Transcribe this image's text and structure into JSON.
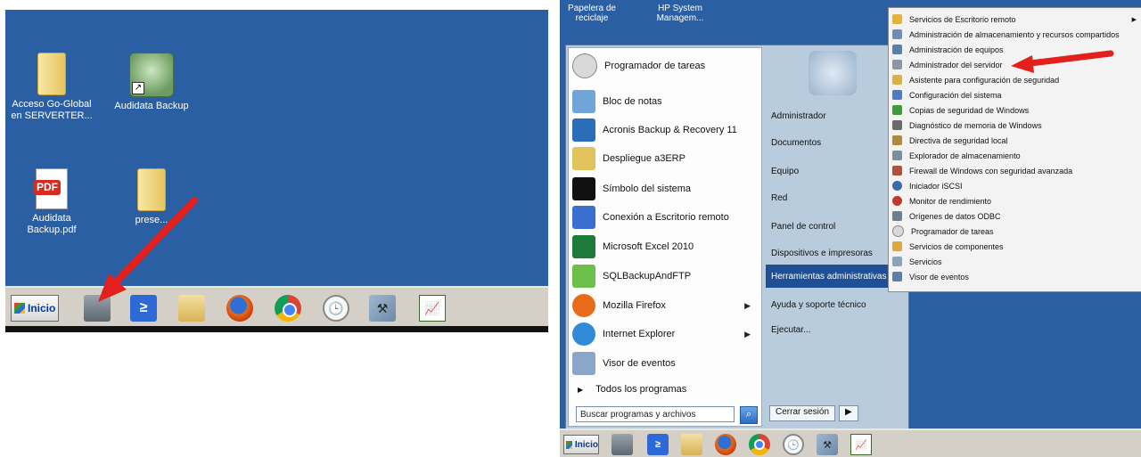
{
  "left_panel": {
    "desktop_icons": [
      {
        "label": "Acceso Go-Global en SERVERTER...",
        "icon": "folder-icon"
      },
      {
        "label": "Audidata Backup",
        "icon": "audidata-app-icon"
      },
      {
        "label": "Audidata Backup.pdf",
        "icon": "pdf-icon"
      },
      {
        "label": "prese...",
        "icon": "folder-icon"
      }
    ],
    "taskbar": {
      "start_label": "Inicio",
      "icons": [
        "server-manager-icon",
        "powershell-icon",
        "explorer-icon",
        "firefox-icon",
        "chrome-icon",
        "clock-icon",
        "admin-tools-icon",
        "performance-chart-icon"
      ]
    },
    "pdf_badge": "PDF",
    "shortcut_glyph": "↗",
    "ps_glyph": "≥",
    "clock_glyph": "🕒",
    "tools_glyph": "⚒",
    "chart_glyph": "📈"
  },
  "right_panel": {
    "desktop_labels": [
      "Papelera de reciclaje",
      "HP System Managem..."
    ],
    "start_menu": {
      "programs": [
        {
          "label": "Programador de tareas",
          "icon": "task-scheduler-icon",
          "color": "#d9d9d9"
        },
        {
          "label": "Bloc de notas",
          "icon": "notepad-icon",
          "color": "#6fa5d9"
        },
        {
          "label": "Acronis Backup & Recovery 11",
          "icon": "acronis-icon",
          "color": "#2a6db8"
        },
        {
          "label": "Despliegue a3ERP",
          "icon": "a3erp-icon",
          "color": "#e0c35c"
        },
        {
          "label": "Símbolo del sistema",
          "icon": "cmd-icon",
          "color": "#111111"
        },
        {
          "label": "Conexión a Escritorio remoto",
          "icon": "remote-desktop-icon",
          "color": "#3b6fcf"
        },
        {
          "label": "Microsoft Excel 2010",
          "icon": "excel-icon",
          "color": "#1e7a3a"
        },
        {
          "label": "SQLBackupAndFTP",
          "icon": "sqlbackup-icon",
          "color": "#6cbf4a"
        },
        {
          "label": "Mozilla Firefox",
          "icon": "firefox-icon",
          "color": "#e86b1a",
          "arrow": true
        },
        {
          "label": "Internet Explorer",
          "icon": "ie-icon",
          "color": "#2f8ad8",
          "arrow": true
        },
        {
          "label": "Visor de eventos",
          "icon": "event-viewer-icon",
          "color": "#8aa6c8"
        }
      ],
      "all_programs": "Todos los programas",
      "search_placeholder": "Buscar programas y archivos",
      "right_items": [
        {
          "label": "Administrador"
        },
        {
          "label": "Documentos"
        },
        {
          "label": "Equipo"
        },
        {
          "label": "Red"
        },
        {
          "label": "Panel de control"
        },
        {
          "label": "Dispositivos e impresoras"
        },
        {
          "label": "Herramientas administrativas",
          "highlighted": true,
          "arrow": true
        },
        {
          "label": "Ayuda y soporte técnico"
        },
        {
          "label": "Ejecutar..."
        }
      ],
      "logout_label": "Cerrar sesión",
      "logout_arrow": "▶",
      "submenu_arrow": "▶"
    },
    "admin_tools_submenu": [
      {
        "label": "Servicios de Escritorio remoto",
        "color": "#e2b43b",
        "arrow": true
      },
      {
        "label": "Administración de almacenamiento y recursos compartidos",
        "color": "#6c8fb8"
      },
      {
        "label": "Administración de equipos",
        "color": "#5a7fa8"
      },
      {
        "label": "Administrador del servidor",
        "color": "#8a96a3"
      },
      {
        "label": "Asistente para configuración de seguridad",
        "color": "#d9b04a"
      },
      {
        "label": "Configuración del sistema",
        "color": "#4d7cc0"
      },
      {
        "label": "Copias de seguridad de Windows",
        "color": "#3d9a3d"
      },
      {
        "label": "Diagnóstico de memoria de Windows",
        "color": "#6b6b6b"
      },
      {
        "label": "Directiva de seguridad local",
        "color": "#b08a3a"
      },
      {
        "label": "Explorador de almacenamiento",
        "color": "#7b8fa3"
      },
      {
        "label": "Firewall de Windows con seguridad avanzada",
        "color": "#b0523a"
      },
      {
        "label": "Iniciador iSCSI",
        "color": "#3a6ab0"
      },
      {
        "label": "Monitor de rendimiento",
        "color": "#c0392b"
      },
      {
        "label": "Orígenes de datos ODBC",
        "color": "#6f7f8f"
      },
      {
        "label": "Programador de tareas",
        "color": "#d9d9d9"
      },
      {
        "label": "Servicios de componentes",
        "color": "#e0a83a"
      },
      {
        "label": "Servicios",
        "color": "#8fa3b8"
      },
      {
        "label": "Visor de eventos",
        "color": "#5a7fa8"
      }
    ],
    "taskbar": {
      "start_label": "Inicio"
    }
  },
  "colors": {
    "desktop": "#2b5fa3",
    "highlight": "#1f4f95",
    "annotation_arrow": "#e3201b"
  }
}
